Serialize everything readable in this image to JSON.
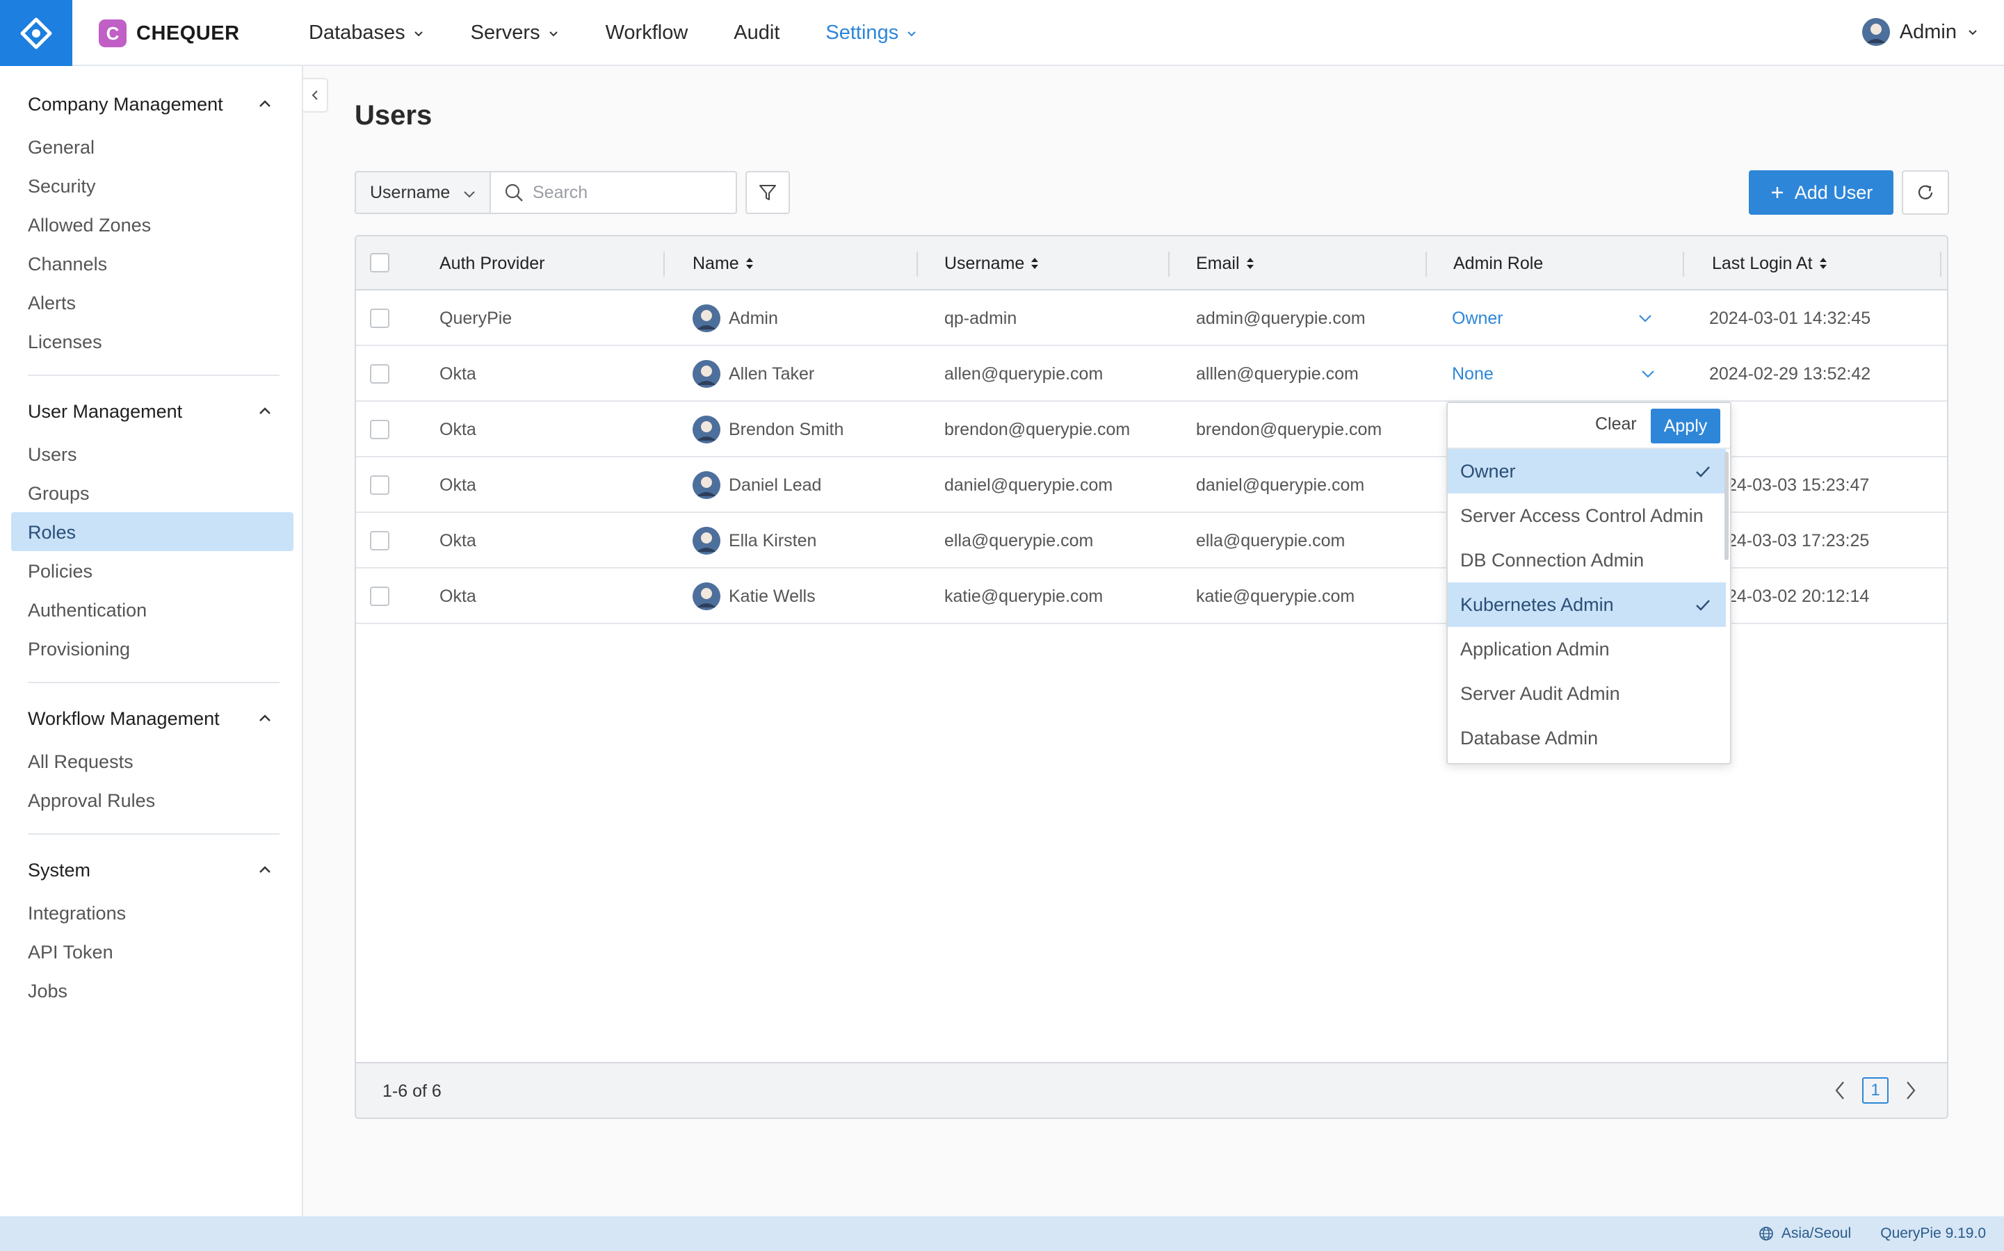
{
  "brand": {
    "name": "CHEQUER",
    "badge": "C"
  },
  "nav": [
    {
      "label": "Databases",
      "dropdown": true,
      "active": false
    },
    {
      "label": "Servers",
      "dropdown": true,
      "active": false
    },
    {
      "label": "Workflow",
      "dropdown": false,
      "active": false
    },
    {
      "label": "Audit",
      "dropdown": false,
      "active": false
    },
    {
      "label": "Settings",
      "dropdown": true,
      "active": true
    }
  ],
  "user_menu": {
    "label": "Admin"
  },
  "sidebar": {
    "groups": [
      {
        "title": "Company Management",
        "items": [
          "General",
          "Security",
          "Allowed Zones",
          "Channels",
          "Alerts",
          "Licenses"
        ]
      },
      {
        "title": "User Management",
        "items": [
          "Users",
          "Groups",
          "Roles",
          "Policies",
          "Authentication",
          "Provisioning"
        ]
      },
      {
        "title": "Workflow Management",
        "items": [
          "All Requests",
          "Approval Rules"
        ]
      },
      {
        "title": "System",
        "items": [
          "Integrations",
          "API Token",
          "Jobs"
        ]
      }
    ],
    "active_item": "Roles"
  },
  "page": {
    "title": "Users"
  },
  "toolbar": {
    "filter_field": "Username",
    "search_placeholder": "Search",
    "add_user_label": "Add User"
  },
  "table": {
    "columns": [
      "Auth Provider",
      "Name",
      "Username",
      "Email",
      "Admin Role",
      "Last Login At"
    ],
    "rows": [
      {
        "auth": "QueryPie",
        "name": "Admin",
        "username": "qp-admin",
        "email": "admin@querypie.com",
        "role": "Owner",
        "last_login": "2024-03-01 14:32:45"
      },
      {
        "auth": "Okta",
        "name": "Allen Taker",
        "username": "allen@querypie.com",
        "email": "alllen@querypie.com",
        "role": "None",
        "last_login": "2024-02-29 13:52:42"
      },
      {
        "auth": "Okta",
        "name": "Brendon Smith",
        "username": "brendon@querypie.com",
        "email": "brendon@querypie.com",
        "role": "",
        "last_login": ""
      },
      {
        "auth": "Okta",
        "name": "Daniel Lead",
        "username": "daniel@querypie.com",
        "email": "daniel@querypie.com",
        "role": "",
        "last_login": "24-03-03 15:23:47"
      },
      {
        "auth": "Okta",
        "name": "Ella Kirsten",
        "username": "ella@querypie.com",
        "email": "ella@querypie.com",
        "role": "",
        "last_login": "24-03-03 17:23:25"
      },
      {
        "auth": "Okta",
        "name": "Katie Wells",
        "username": "katie@querypie.com",
        "email": "katie@querypie.com",
        "role": "",
        "last_login": "24-03-02 20:12:14"
      }
    ],
    "range_text": "1-6 of 6",
    "current_page": "1"
  },
  "dropdown": {
    "clear_label": "Clear",
    "apply_label": "Apply",
    "options": [
      {
        "label": "Owner",
        "selected": true
      },
      {
        "label": "Server Access Control Admin",
        "selected": false
      },
      {
        "label": "DB Connection Admin",
        "selected": false
      },
      {
        "label": "Kubernetes Admin",
        "selected": true
      },
      {
        "label": "Application Admin",
        "selected": false
      },
      {
        "label": "Server Audit Admin",
        "selected": false
      },
      {
        "label": "Database Admin",
        "selected": false
      }
    ]
  },
  "status": {
    "timezone": "Asia/Seoul",
    "version": "QueryPie 9.19.0"
  },
  "colors": {
    "accent": "#2e86d8",
    "selected_bg": "#c9e2f8",
    "brand_badge": "#c060c6"
  }
}
